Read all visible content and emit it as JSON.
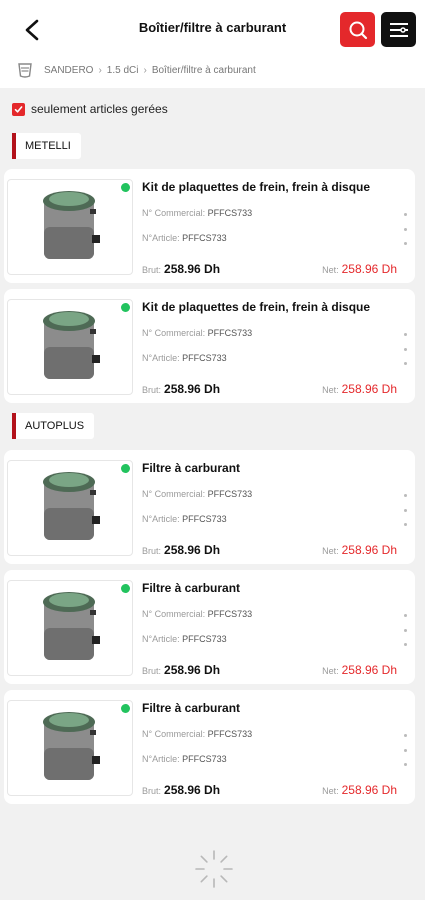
{
  "header": {
    "title": "Boîtier/filtre à carburant"
  },
  "breadcrumb": {
    "items": [
      "SANDERO",
      "1.5 dCi",
      "Boîtier/filtre à carburant"
    ]
  },
  "filter": {
    "label": "seulement articles gerées",
    "checked": true
  },
  "sections": [
    {
      "label": "METELLI",
      "products": [
        {
          "name": "Kit de plaquettes de frein, frein à disque",
          "commercial_label": "N° Commercial:",
          "commercial_value": "PFFCS733",
          "article_label": "N°Article:",
          "article_value": "PFFCS733",
          "brut_label": "Brut:",
          "brut_value": "258.96 Dh",
          "net_label": "Net:",
          "net_value": "258.96 Dh",
          "status": "available"
        },
        {
          "name": "Kit de plaquettes de frein, frein à disque",
          "commercial_label": "N° Commercial:",
          "commercial_value": "PFFCS733",
          "article_label": "N°Article:",
          "article_value": "PFFCS733",
          "brut_label": "Brut:",
          "brut_value": "258.96 Dh",
          "net_label": "Net:",
          "net_value": "258.96 Dh",
          "status": "available"
        }
      ]
    },
    {
      "label": "AUTOPLUS",
      "products": [
        {
          "name": "Filtre à carburant",
          "commercial_label": "N° Commercial:",
          "commercial_value": "PFFCS733",
          "article_label": "N°Article:",
          "article_value": "PFFCS733",
          "brut_label": "Brut:",
          "brut_value": "258.96 Dh",
          "net_label": "Net:",
          "net_value": "258.96 Dh",
          "status": "available"
        },
        {
          "name": "Filtre à carburant",
          "commercial_label": "N° Commercial:",
          "commercial_value": "PFFCS733",
          "article_label": "N°Article:",
          "article_value": "PFFCS733",
          "brut_label": "Brut:",
          "brut_value": "258.96 Dh",
          "net_label": "Net:",
          "net_value": "258.96 Dh",
          "status": "available"
        },
        {
          "name": "Filtre à carburant",
          "commercial_label": "N° Commercial:",
          "commercial_value": "PFFCS733",
          "article_label": "N°Article:",
          "article_value": "PFFCS733",
          "brut_label": "Brut:",
          "brut_value": "258.96 Dh",
          "net_label": "Net:",
          "net_value": "258.96 Dh",
          "status": "available"
        }
      ]
    }
  ],
  "icons": {
    "back": "arrow-left-icon",
    "search": "search-icon",
    "menu": "menu-icon",
    "brand": "car-brand-icon",
    "product": "fuel-filter-image",
    "spinner": "loading-spinner-icon"
  },
  "colors": {
    "accent": "#e4282b",
    "section_bar": "#b3121b",
    "status_available": "#22c35e",
    "menu_button": "#111111"
  }
}
